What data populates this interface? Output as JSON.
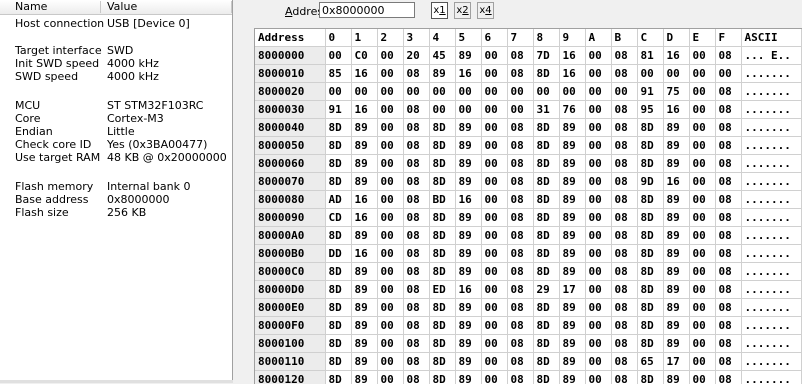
{
  "properties": {
    "header": {
      "name": "Name",
      "value": "Value"
    },
    "rows": [
      {
        "name": "Host connection",
        "value": "USB [Device 0]"
      },
      {
        "name": "Target interface",
        "value": "SWD"
      },
      {
        "name": "Init SWD speed",
        "value": "4000 kHz"
      },
      {
        "name": "SWD speed",
        "value": "4000 kHz"
      },
      {
        "name": "MCU",
        "value": "ST STM32F103RC"
      },
      {
        "name": "Core",
        "value": "Cortex-M3"
      },
      {
        "name": "Endian",
        "value": "Little"
      },
      {
        "name": "Check core ID",
        "value": "Yes (0x3BA00477)"
      },
      {
        "name": "Use target RAM",
        "value": "48 KB @ 0x20000000"
      },
      {
        "name": "Flash memory",
        "value": "Internal bank 0"
      },
      {
        "name": "Base address",
        "value": "0x8000000"
      },
      {
        "name": "Flash size",
        "value": "256 KB"
      }
    ]
  },
  "toolbar": {
    "address_label_underlined": "A",
    "address_label_rest": "ddress:",
    "address_value": "0x8000000",
    "zoom": [
      {
        "prefix": "x",
        "digit": "1",
        "active": true
      },
      {
        "prefix": "x",
        "digit": "2",
        "active": false
      },
      {
        "prefix": "x",
        "digit": "4",
        "active": false
      }
    ]
  },
  "hex": {
    "columns": [
      "Address",
      "0",
      "1",
      "2",
      "3",
      "4",
      "5",
      "6",
      "7",
      "8",
      "9",
      "A",
      "B",
      "C",
      "D",
      "E",
      "F",
      "ASCII"
    ],
    "rows": [
      {
        "address": "8000000",
        "bytes": [
          "00",
          "C0",
          "00",
          "20",
          "45",
          "89",
          "00",
          "08",
          "7D",
          "16",
          "00",
          "08",
          "81",
          "16",
          "00",
          "08"
        ],
        "ascii": "... E.."
      },
      {
        "address": "8000010",
        "bytes": [
          "85",
          "16",
          "00",
          "08",
          "89",
          "16",
          "00",
          "08",
          "8D",
          "16",
          "00",
          "08",
          "00",
          "00",
          "00",
          "00"
        ],
        "ascii": "......."
      },
      {
        "address": "8000020",
        "bytes": [
          "00",
          "00",
          "00",
          "00",
          "00",
          "00",
          "00",
          "00",
          "00",
          "00",
          "00",
          "00",
          "91",
          "75",
          "00",
          "08"
        ],
        "ascii": "......."
      },
      {
        "address": "8000030",
        "bytes": [
          "91",
          "16",
          "00",
          "08",
          "00",
          "00",
          "00",
          "00",
          "31",
          "76",
          "00",
          "08",
          "95",
          "16",
          "00",
          "08"
        ],
        "ascii": "......."
      },
      {
        "address": "8000040",
        "bytes": [
          "8D",
          "89",
          "00",
          "08",
          "8D",
          "89",
          "00",
          "08",
          "8D",
          "89",
          "00",
          "08",
          "8D",
          "89",
          "00",
          "08"
        ],
        "ascii": "......."
      },
      {
        "address": "8000050",
        "bytes": [
          "8D",
          "89",
          "00",
          "08",
          "8D",
          "89",
          "00",
          "08",
          "8D",
          "89",
          "00",
          "08",
          "8D",
          "89",
          "00",
          "08"
        ],
        "ascii": "......."
      },
      {
        "address": "8000060",
        "bytes": [
          "8D",
          "89",
          "00",
          "08",
          "8D",
          "89",
          "00",
          "08",
          "8D",
          "89",
          "00",
          "08",
          "8D",
          "89",
          "00",
          "08"
        ],
        "ascii": "......."
      },
      {
        "address": "8000070",
        "bytes": [
          "8D",
          "89",
          "00",
          "08",
          "8D",
          "89",
          "00",
          "08",
          "8D",
          "89",
          "00",
          "08",
          "9D",
          "16",
          "00",
          "08"
        ],
        "ascii": "......."
      },
      {
        "address": "8000080",
        "bytes": [
          "AD",
          "16",
          "00",
          "08",
          "BD",
          "16",
          "00",
          "08",
          "8D",
          "89",
          "00",
          "08",
          "8D",
          "89",
          "00",
          "08"
        ],
        "ascii": "......."
      },
      {
        "address": "8000090",
        "bytes": [
          "CD",
          "16",
          "00",
          "08",
          "8D",
          "89",
          "00",
          "08",
          "8D",
          "89",
          "00",
          "08",
          "8D",
          "89",
          "00",
          "08"
        ],
        "ascii": "......."
      },
      {
        "address": "80000A0",
        "bytes": [
          "8D",
          "89",
          "00",
          "08",
          "8D",
          "89",
          "00",
          "08",
          "8D",
          "89",
          "00",
          "08",
          "8D",
          "89",
          "00",
          "08"
        ],
        "ascii": "......."
      },
      {
        "address": "80000B0",
        "bytes": [
          "DD",
          "16",
          "00",
          "08",
          "8D",
          "89",
          "00",
          "08",
          "8D",
          "89",
          "00",
          "08",
          "8D",
          "89",
          "00",
          "08"
        ],
        "ascii": "......."
      },
      {
        "address": "80000C0",
        "bytes": [
          "8D",
          "89",
          "00",
          "08",
          "8D",
          "89",
          "00",
          "08",
          "8D",
          "89",
          "00",
          "08",
          "8D",
          "89",
          "00",
          "08"
        ],
        "ascii": "......."
      },
      {
        "address": "80000D0",
        "bytes": [
          "8D",
          "89",
          "00",
          "08",
          "ED",
          "16",
          "00",
          "08",
          "29",
          "17",
          "00",
          "08",
          "8D",
          "89",
          "00",
          "08"
        ],
        "ascii": "......."
      },
      {
        "address": "80000E0",
        "bytes": [
          "8D",
          "89",
          "00",
          "08",
          "8D",
          "89",
          "00",
          "08",
          "8D",
          "89",
          "00",
          "08",
          "8D",
          "89",
          "00",
          "08"
        ],
        "ascii": "......."
      },
      {
        "address": "80000F0",
        "bytes": [
          "8D",
          "89",
          "00",
          "08",
          "8D",
          "89",
          "00",
          "08",
          "8D",
          "89",
          "00",
          "08",
          "8D",
          "89",
          "00",
          "08"
        ],
        "ascii": "......."
      },
      {
        "address": "8000100",
        "bytes": [
          "8D",
          "89",
          "00",
          "08",
          "8D",
          "89",
          "00",
          "08",
          "8D",
          "89",
          "00",
          "08",
          "8D",
          "89",
          "00",
          "08"
        ],
        "ascii": "......."
      },
      {
        "address": "8000110",
        "bytes": [
          "8D",
          "89",
          "00",
          "08",
          "8D",
          "89",
          "00",
          "08",
          "8D",
          "89",
          "00",
          "08",
          "65",
          "17",
          "00",
          "08"
        ],
        "ascii": "......."
      },
      {
        "address": "8000120",
        "bytes": [
          "8D",
          "89",
          "00",
          "08",
          "8D",
          "89",
          "00",
          "08",
          "8D",
          "89",
          "00",
          "08",
          "8D",
          "89",
          "00",
          "08"
        ],
        "ascii": "......."
      }
    ]
  }
}
